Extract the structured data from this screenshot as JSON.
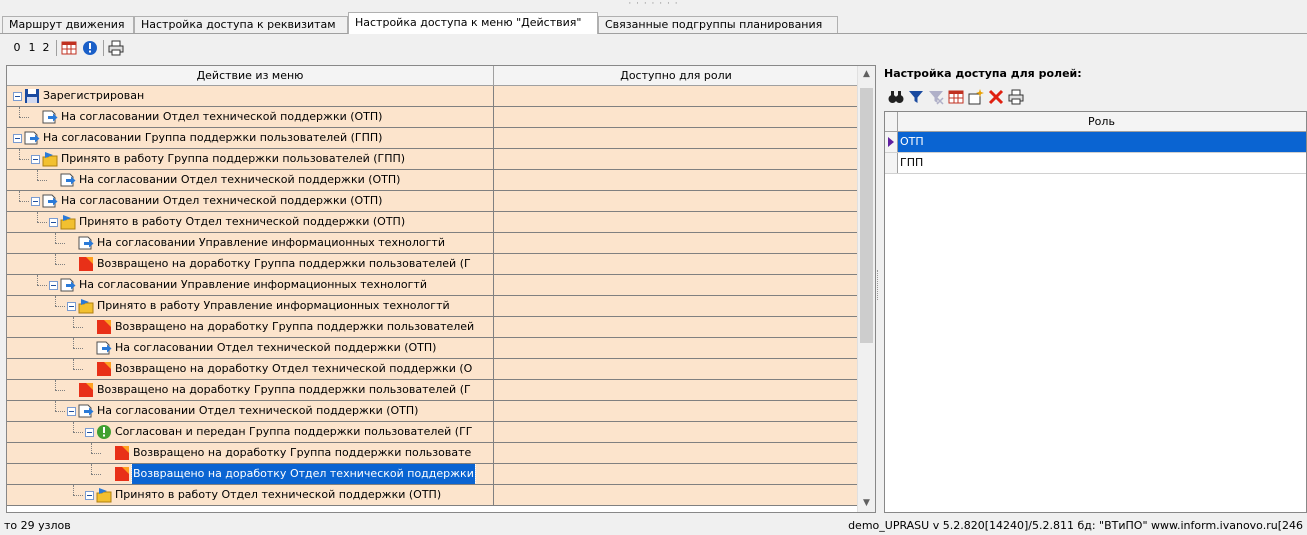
{
  "tabs": [
    {
      "label": "Маршрут движения"
    },
    {
      "label": "Настройка доступа к реквизитам"
    },
    {
      "label": "Настройка доступа к меню \"Действия\""
    },
    {
      "label": "Связанные подгруппы планирования"
    }
  ],
  "toolbar": {
    "level0": "0",
    "level1": "1",
    "level2": "2"
  },
  "grid": {
    "col_action": "Действие из меню",
    "col_role": "Доступно для роли",
    "rows": [
      {
        "label": "Зарегистрирован",
        "icon": "save-icon"
      },
      {
        "label": "На согласовании Отдел технической поддержки (ОТП)",
        "icon": "doc-arrow-icon"
      },
      {
        "label": "На согласовании Группа поддержки пользователей (ГПП)",
        "icon": "doc-arrow-icon"
      },
      {
        "label": "Принято в работу Группа поддержки пользователей (ГПП)",
        "icon": "folder-arrow-icon"
      },
      {
        "label": "На согласовании Отдел технической поддержки (ОТП)",
        "icon": "doc-arrow-icon"
      },
      {
        "label": "На согласовании Отдел технической поддержки (ОТП)",
        "icon": "doc-arrow-icon"
      },
      {
        "label": "Принято в работу Отдел технической поддержки (ОТП)",
        "icon": "folder-arrow-icon"
      },
      {
        "label": "На согласовании Управление информационных технологтй",
        "icon": "doc-arrow-icon"
      },
      {
        "label": "Возвращено на доработку Группа поддержки пользователей (Г",
        "icon": "return-icon"
      },
      {
        "label": "На согласовании Управление информационных технологтй",
        "icon": "doc-arrow-icon"
      },
      {
        "label": "Принято в работу Управление информационных технологтй",
        "icon": "folder-arrow-icon"
      },
      {
        "label": "Возвращено на доработку Группа поддержки пользователей",
        "icon": "return-icon"
      },
      {
        "label": "На согласовании Отдел технической поддержки (ОТП)",
        "icon": "doc-arrow-icon"
      },
      {
        "label": "Возвращено на доработку Отдел технической поддержки (О",
        "icon": "return-icon"
      },
      {
        "label": "Возвращено на доработку Группа поддержки пользователей (Г",
        "icon": "return-icon"
      },
      {
        "label": "На согласовании Отдел технической поддержки (ОТП)",
        "icon": "doc-arrow-icon"
      },
      {
        "label": "Согласован и передан Группа поддержки пользователей (ГГ",
        "icon": "approve-icon"
      },
      {
        "label": "Возвращено на доработку Группа поддержки пользовате",
        "icon": "return-icon"
      },
      {
        "label": "Возвращено на доработку Отдел технической поддержки",
        "icon": "return-icon"
      },
      {
        "label": "Принято в работу Отдел технической поддержки (ОТП)",
        "icon": "folder-arrow-icon"
      }
    ]
  },
  "roles": {
    "title": "Настройка доступа для ролей:",
    "col_role": "Роль",
    "rows": [
      {
        "value": "ОТП"
      },
      {
        "value": "ГПП"
      }
    ]
  },
  "status": {
    "left": "то 29 узлов",
    "right": "demo_UPRASU  v 5.2.820[14240]/5.2.811 бд: \"ВТиПО\" www.inform.ivanovo.ru[246"
  },
  "colors": {
    "row_bg": "#fce4cc",
    "selection": "#0a64d2"
  }
}
